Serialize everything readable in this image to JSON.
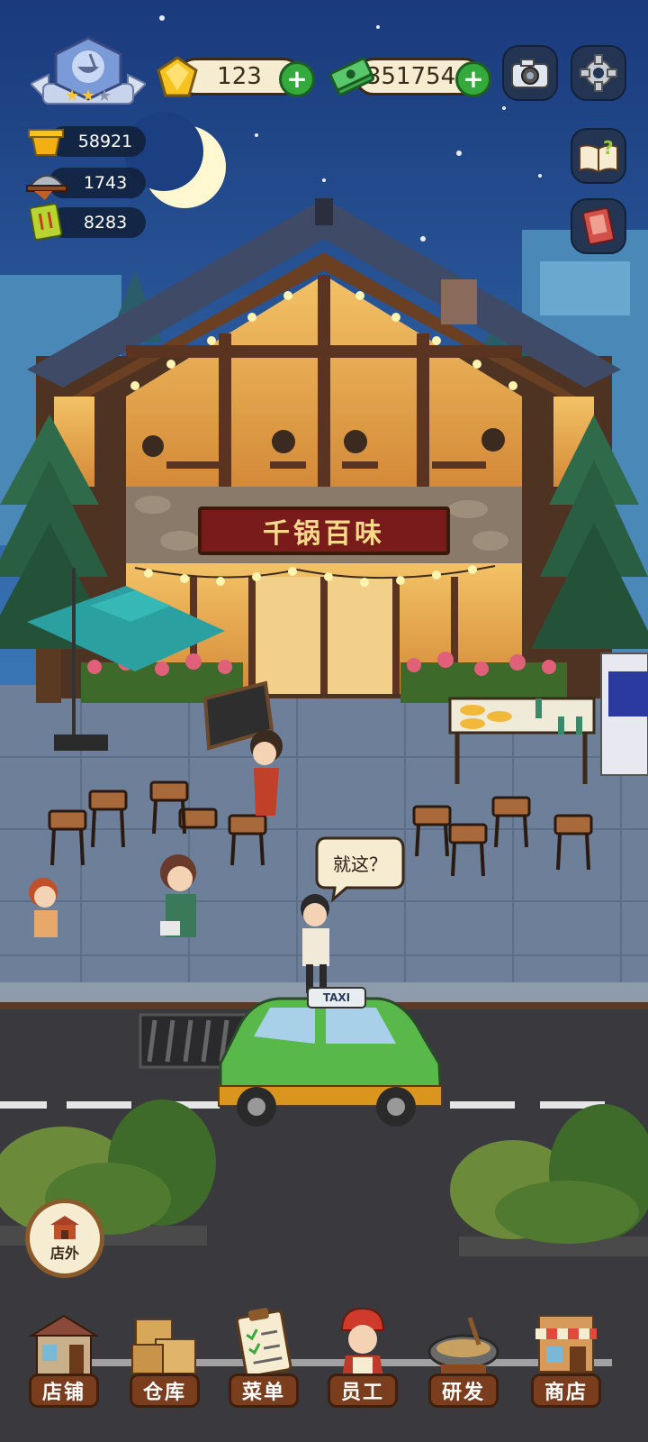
{
  "currencies": {
    "gems": "123",
    "cash": "351754"
  },
  "stats": [
    {
      "icon": "gold-pot-icon",
      "value": "58921"
    },
    {
      "icon": "serving-cloche-icon",
      "value": "1743"
    },
    {
      "icon": "recipe-book-icon",
      "value": "8283"
    }
  ],
  "top_buttons": [
    "camera-icon",
    "gear-icon",
    "help-book-icon",
    "journal-icon"
  ],
  "restaurant": {
    "sign": "千锅百味"
  },
  "speech_bubble": "就这？",
  "taxi_sign": "TAXI",
  "outside_button": "店外",
  "bottom_nav": [
    {
      "label": "店铺",
      "icon": "shop-building-icon"
    },
    {
      "label": "仓库",
      "icon": "crates-icon"
    },
    {
      "label": "菜单",
      "icon": "clipboard-icon"
    },
    {
      "label": "员工",
      "icon": "chef-icon"
    },
    {
      "label": "研发",
      "icon": "wok-icon"
    },
    {
      "label": "商店",
      "icon": "storefront-icon"
    }
  ],
  "colors": {
    "sky": "#1b3f80",
    "wood": "#5a3420",
    "sign_red": "#7a1b1b",
    "taxi_green": "#58b84a",
    "accent_green": "#34a93c"
  }
}
